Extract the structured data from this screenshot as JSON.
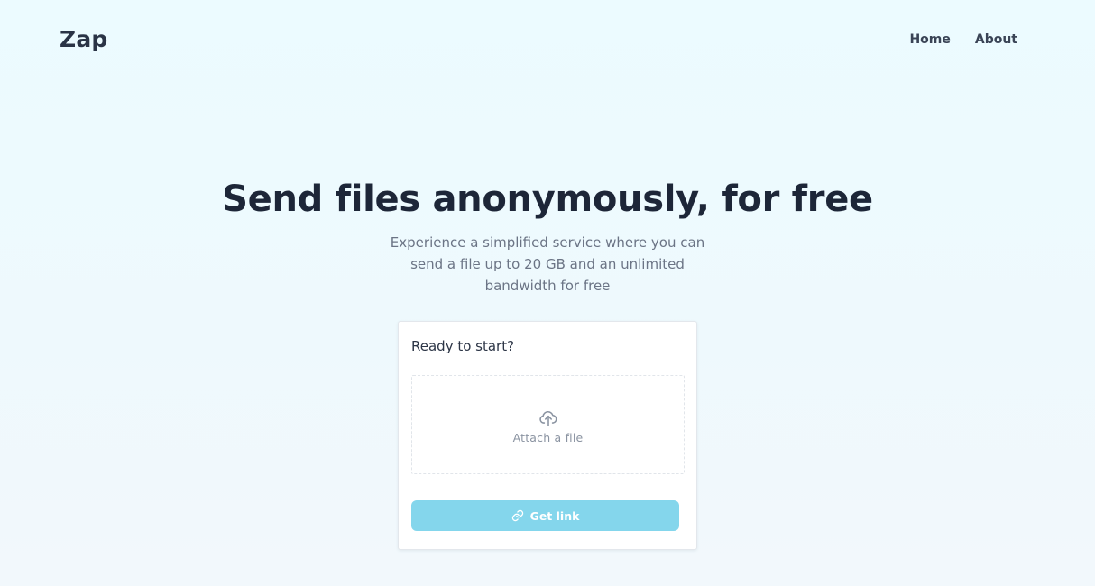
{
  "header": {
    "brand": "Zap",
    "nav": [
      {
        "label": "Home"
      },
      {
        "label": "About"
      }
    ]
  },
  "hero": {
    "title": "Send files anonymously, for free",
    "subtitle": "Experience a simplified service where you can send a file up to 20 GB and an unlimited bandwidth for free"
  },
  "upload_card": {
    "title": "Ready to start?",
    "dropzone_label": "Attach a file",
    "dropzone_icon": "cloud-upload-icon",
    "button_label": "Get link",
    "button_icon": "link-icon",
    "button_disabled": true
  },
  "colors": {
    "page_background": "#ecfbff",
    "text_dark": "#1d2638",
    "text_muted": "#6b7485",
    "button_background": "#84d6ec",
    "button_text": "#ffffff",
    "card_background": "#ffffff"
  }
}
